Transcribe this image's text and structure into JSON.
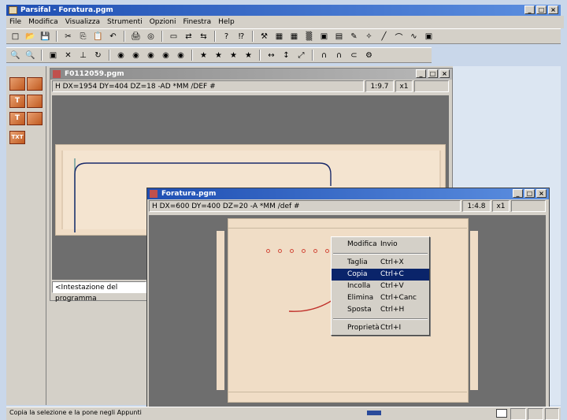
{
  "app": {
    "title": "Parsifal - Foratura.pgm",
    "buttons": [
      "_",
      "□",
      "×"
    ]
  },
  "menu": [
    "File",
    "Modifica",
    "Visualizza",
    "Strumenti",
    "Opzioni",
    "Finestra",
    "Help"
  ],
  "toolbar1": [
    "new-icon",
    "open-icon",
    "save-icon",
    "cut-icon",
    "copy-icon",
    "paste-icon",
    "undo-icon",
    "print-icon",
    "preview-icon",
    "monitor-icon",
    "transfer-icon",
    "transfer2-icon",
    "help-icon",
    "whatsthis-icon",
    "tool-icon",
    "measure-icon",
    "grid-icon",
    "layers-icon",
    "disk-icon",
    "page-icon",
    "pencil-icon",
    "shape-icon",
    "line-icon",
    "arc-icon",
    "curve-icon",
    "drill-icon"
  ],
  "toolbar2": [
    "zoom-in-icon",
    "zoom-out-icon",
    "select-icon",
    "cross-icon",
    "axis-icon",
    "rotate-icon",
    "hole1-icon",
    "hole2-icon",
    "hole3-icon",
    "hole4-icon",
    "hole5-icon",
    "mill1-icon",
    "mill2-icon",
    "mill3-icon",
    "mill4-icon",
    "mirror-x-icon",
    "mirror-y-icon",
    "mirror-xy-icon",
    "arc-a-icon",
    "arc-b-icon",
    "arc-c-icon",
    "code-icon"
  ],
  "toolbar2_glyphs": [
    "🔍",
    "🔍",
    "▣",
    "✕",
    "⊥",
    "↻",
    "◉",
    "◉",
    "◉",
    "◉",
    "◉",
    "★",
    "★",
    "★",
    "★",
    "↔",
    "↕",
    "⤢",
    "∩",
    "∩",
    "⊂",
    "⚙"
  ],
  "leftTools": [
    "",
    "",
    "T",
    "",
    "T",
    "",
    "TXT"
  ],
  "win1": {
    "title": "F0112059.pgm",
    "header": "H DX=1954 DY=404 DZ=18 -AD *MM /DEF #",
    "scale": "1:9.7",
    "zoom": "x1",
    "footer": "<Intestazione del programma"
  },
  "win2": {
    "title": "Foratura.pgm",
    "header": "H DX=600 DY=400 DZ=20 -A *MM /def #",
    "scale": "1:4.8",
    "zoom": "x1"
  },
  "context": {
    "items": [
      {
        "label": "Modifica",
        "shortcut": "Invio"
      },
      {
        "label": "Taglia",
        "shortcut": "Ctrl+X"
      },
      {
        "label": "Copia",
        "shortcut": "Ctrl+C"
      },
      {
        "label": "Incolla",
        "shortcut": "Ctrl+V"
      },
      {
        "label": "Elimina",
        "shortcut": "Ctrl+Canc"
      },
      {
        "label": "Sposta",
        "shortcut": "Ctrl+H"
      },
      {
        "label": "Proprietà",
        "shortcut": "Ctrl+I"
      }
    ],
    "selected": 2
  },
  "status": {
    "text": "Copia la selezione e la pone negli Appunti"
  },
  "colors": {
    "panel": "#f0ddc6",
    "mdi": "#6e6e6e",
    "accent": "#0a246a"
  }
}
